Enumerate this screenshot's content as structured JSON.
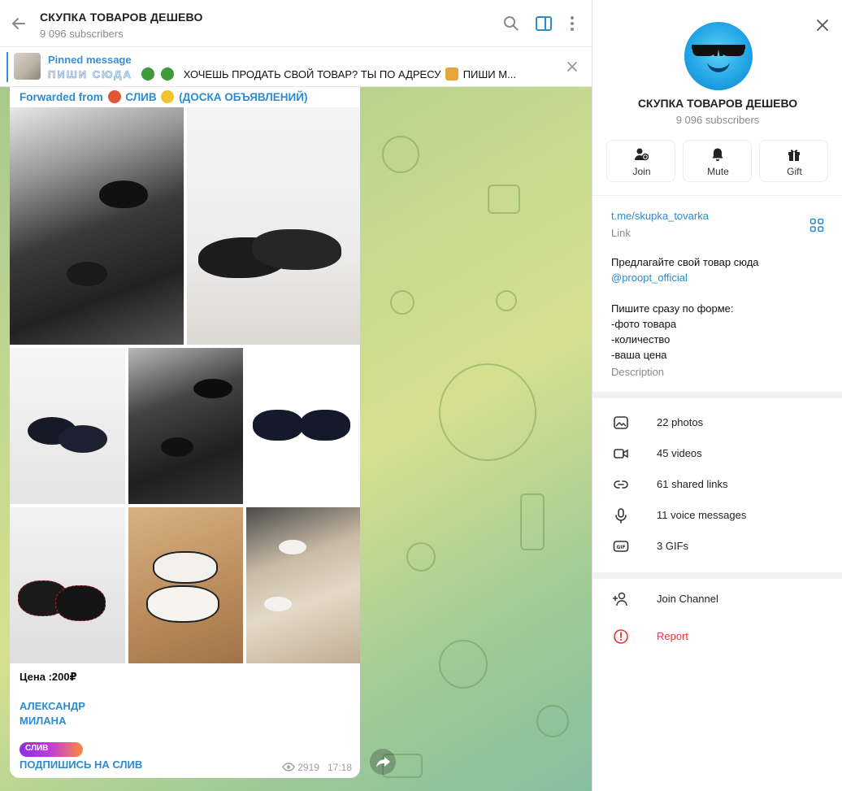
{
  "header": {
    "title": "СКУПКА ТОВАРОВ ДЕШЕВО",
    "subscribers": "9 096 subscribers"
  },
  "pinned": {
    "label": "Pinned message",
    "big_text": "ПИШИ СЮДА",
    "text": "ХОЧЕШЬ ПРОДАТЬ СВОЙ ТОВАР? ТЫ ПО АДРЕСУ",
    "text_end": "ПИШИ М..."
  },
  "message": {
    "forwarded_prefix": "Forwarded from",
    "forwarded_source_a": "СЛИВ",
    "forwarded_source_b": "(ДОСКА ОБЪЯВЛЕНИЙ)",
    "price": "Цена :200₽",
    "name_1": "АЛЕКСАНДР",
    "name_2": "МИЛАНА",
    "badge": "СЛИВ",
    "subscribe": "ПОДПИШИСЬ НА СЛИВ",
    "views": "2919",
    "time": "17:18"
  },
  "panel": {
    "title": "СКУПКА ТОВАРОВ ДЕШЕВО",
    "subscribers": "9 096 subscribers",
    "actions": [
      {
        "label": "Join",
        "icon": "add-user-icon"
      },
      {
        "label": "Mute",
        "icon": "bell-icon"
      },
      {
        "label": "Gift",
        "icon": "gift-icon"
      }
    ],
    "link": "t.me/skupka_tovarka",
    "link_caption": "Link",
    "description_lines": [
      "Предлагайте свой товар сюда",
      "@proopt_official",
      "",
      "Пишите сразу по форме:",
      "-фото товара",
      "-количество",
      "-ваша цена"
    ],
    "description_caption": "Description",
    "media": [
      {
        "label": "22 photos",
        "icon": "photo-icon"
      },
      {
        "label": "45 videos",
        "icon": "video-icon"
      },
      {
        "label": "61 shared links",
        "icon": "link-icon"
      },
      {
        "label": "11 voice messages",
        "icon": "microphone-icon"
      },
      {
        "label": "3 GIFs",
        "icon": "gif-icon"
      }
    ],
    "join_channel": "Join Channel",
    "report": "Report"
  },
  "colors": {
    "accent": "#2c8ccf",
    "report": "#e53935",
    "chat_bg_light": "#d6e08f",
    "chat_bg_dark": "#86bfa0"
  }
}
